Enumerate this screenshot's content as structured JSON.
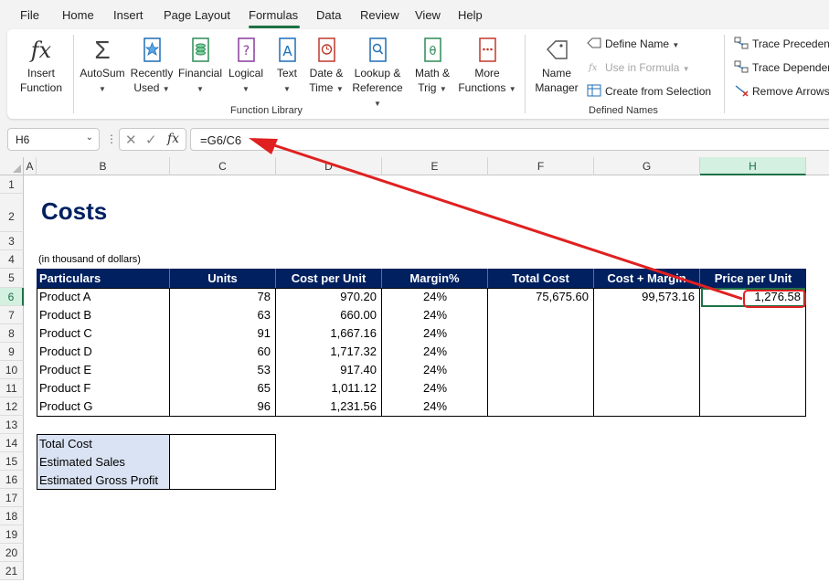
{
  "menu": {
    "tabs": [
      "File",
      "Home",
      "Insert",
      "Page Layout",
      "Formulas",
      "Data",
      "Review",
      "View",
      "Help"
    ],
    "active": "Formulas"
  },
  "ribbon": {
    "insert_function": [
      "Insert",
      "Function"
    ],
    "library": {
      "autosum": "AutoSum",
      "recently_used": [
        "Recently",
        "Used"
      ],
      "financial": "Financial",
      "logical": "Logical",
      "text": "Text",
      "date_time": [
        "Date &",
        "Time"
      ],
      "lookup": [
        "Lookup &",
        "Reference"
      ],
      "math": [
        "Math &",
        "Trig"
      ],
      "more": [
        "More",
        "Functions"
      ],
      "group_label": "Function Library"
    },
    "names": {
      "name_manager": [
        "Name",
        "Manager"
      ],
      "define_name": "Define Name",
      "use_in_formula": "Use in Formula",
      "create_from_selection": "Create from Selection",
      "group_label": "Defined Names"
    },
    "audit": {
      "trace_precedents": "Trace Precedents",
      "trace_dependents": "Trace Dependents",
      "remove_arrows": "Remove Arrows"
    }
  },
  "formula_bar": {
    "name_box": "H6",
    "formula": "=G6/C6"
  },
  "grid": {
    "columns": [
      "A",
      "B",
      "C",
      "D",
      "E",
      "F",
      "G",
      "H"
    ],
    "selected_column": "H",
    "rows": [
      "1",
      "2",
      "3",
      "4",
      "5",
      "6",
      "7",
      "8",
      "9",
      "10",
      "11",
      "12",
      "13",
      "14",
      "15",
      "16",
      "17",
      "18",
      "19",
      "20",
      "21"
    ],
    "selected_row": "6"
  },
  "sheet": {
    "title": "Costs",
    "note": "(in thousand of dollars)",
    "headers": [
      "Particulars",
      "Units",
      "Cost per Unit",
      "Margin%",
      "Total Cost",
      "Cost + Margin",
      "Price per Unit"
    ],
    "rows": [
      {
        "name": "Product A",
        "units": "78",
        "cost": "970.20",
        "margin": "24%",
        "total": "75,675.60",
        "cost_margin": "99,573.16",
        "price": "1,276.58"
      },
      {
        "name": "Product B",
        "units": "63",
        "cost": "660.00",
        "margin": "24%",
        "total": "",
        "cost_margin": "",
        "price": ""
      },
      {
        "name": "Product C",
        "units": "91",
        "cost": "1,667.16",
        "margin": "24%",
        "total": "",
        "cost_margin": "",
        "price": ""
      },
      {
        "name": "Product D",
        "units": "60",
        "cost": "1,717.32",
        "margin": "24%",
        "total": "",
        "cost_margin": "",
        "price": ""
      },
      {
        "name": "Product E",
        "units": "53",
        "cost": "917.40",
        "margin": "24%",
        "total": "",
        "cost_margin": "",
        "price": ""
      },
      {
        "name": "Product F",
        "units": "65",
        "cost": "1,011.12",
        "margin": "24%",
        "total": "",
        "cost_margin": "",
        "price": ""
      },
      {
        "name": "Product G",
        "units": "96",
        "cost": "1,231.56",
        "margin": "24%",
        "total": "",
        "cost_margin": "",
        "price": ""
      }
    ],
    "summary": [
      "Total Cost",
      "Estimated Sales",
      "Estimated Gross Profit"
    ]
  },
  "colors": {
    "header_fill": "#002060",
    "title": "#002060",
    "summary_fill": "#dae3f3",
    "excel_green": "#1e7145",
    "annotation_red": "#e02020"
  }
}
